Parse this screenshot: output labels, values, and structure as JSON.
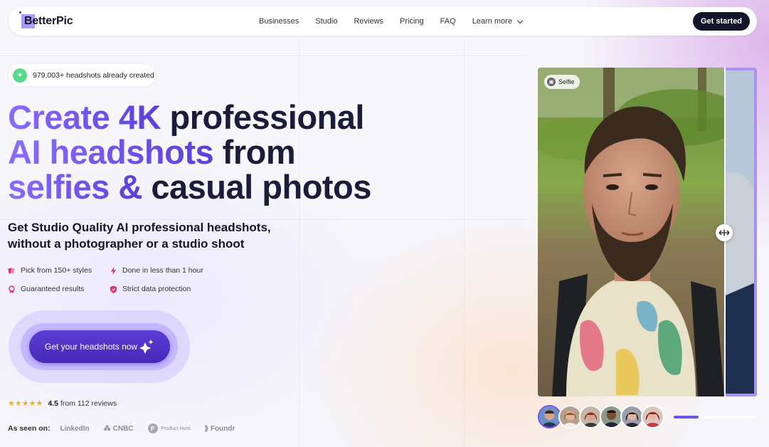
{
  "brand": {
    "name": "BetterPic",
    "accent": "#7b5cf0",
    "dark": "#14142b"
  },
  "nav": {
    "links": [
      "Businesses",
      "Studio",
      "Reviews",
      "Pricing",
      "FAQ",
      "Learn more"
    ],
    "cta": "Get started"
  },
  "badge": {
    "icon": "sparkle-icon",
    "text": "979,003+ headshots already created"
  },
  "hero": {
    "line1_accent": "Create 4K",
    "line1_dark": "professional",
    "line2_accent": "AI headshots",
    "line2_dark": "from",
    "line3_accent": "selfies &",
    "line3_dark": "casual photos",
    "subhead_line1": "Get Studio Quality AI professional headshots,",
    "subhead_line2": "without a photographer or a studio shoot"
  },
  "features": [
    {
      "icon": "palette-icon",
      "text": "Pick from 150+ styles"
    },
    {
      "icon": "bolt-icon",
      "text": "Done in less than 1 hour"
    },
    {
      "icon": "medal-icon",
      "text": "Guaranteed results"
    },
    {
      "icon": "shield-icon",
      "text": "Strict data protection"
    }
  ],
  "cta": {
    "label": "Get your headshots now"
  },
  "rating": {
    "stars": "★★★★★",
    "value": "4.5",
    "text": "from 112 reviews"
  },
  "press": {
    "label": "As seen on:",
    "items": [
      "LinkedIn",
      "CNBC",
      "Product Hunt",
      "Foundr"
    ]
  },
  "compare": {
    "chip": "Selfie",
    "progress": 0.3
  }
}
